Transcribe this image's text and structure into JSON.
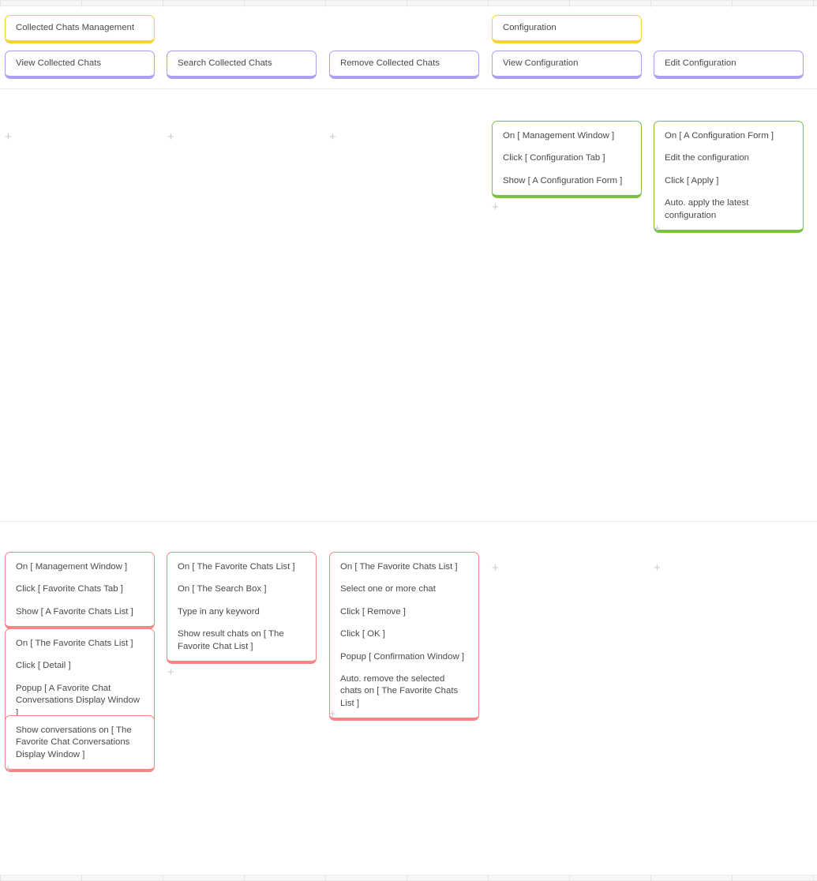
{
  "board": {
    "title_cards": [
      {
        "id": "collected-chats-management",
        "label": "Collected Chats Management",
        "color": "yellow"
      },
      {
        "id": "configuration",
        "label": "Configuration",
        "color": "yellow"
      }
    ],
    "feature_cards": [
      {
        "id": "view-collected-chats",
        "label": "View Collected Chats",
        "color": "purple"
      },
      {
        "id": "search-collected-chats",
        "label": "Search Collected Chats",
        "color": "purple"
      },
      {
        "id": "remove-collected-chats",
        "label": "Remove Collected Chats",
        "color": "purple"
      },
      {
        "id": "view-configuration",
        "label": "View Configuration",
        "color": "purple"
      },
      {
        "id": "edit-configuration",
        "label": "Edit Configuration",
        "color": "purple"
      }
    ],
    "scenario_cards": [
      {
        "id": "view-configuration-scenario",
        "color": "green",
        "steps": [
          "On [ Management Window ]",
          "Click [ Configuration Tab ]",
          "Show [ A Configuration Form ]"
        ]
      },
      {
        "id": "edit-configuration-scenario",
        "color": "green",
        "steps": [
          "On [ A Configuration Form ]",
          "Edit the configuration",
          "Click [ Apply ]",
          "Auto. apply the latest configuration"
        ]
      },
      {
        "id": "view-collected-chats-scenario-1",
        "color": "red",
        "steps": [
          "On [ Management Window ]",
          "Click [ Favorite Chats Tab ]",
          "Show [ A Favorite Chats List ]"
        ]
      },
      {
        "id": "view-collected-chats-scenario-2",
        "color": "red",
        "steps": [
          "On [ The Favorite Chats List ]",
          "Click [ Detail ]",
          "Popup [ A Favorite Chat Conversations Display Window ]"
        ]
      },
      {
        "id": "view-collected-chats-scenario-3",
        "color": "red",
        "steps": [
          "Show conversations on [ The Favorite Chat Conversations Display Window ]"
        ]
      },
      {
        "id": "search-collected-chats-scenario",
        "color": "red",
        "steps": [
          "On [ The Favorite Chats List ]",
          "On [ The Search Box ]",
          "Type in any keyword",
          "Show result chats on [ The Favorite Chat List ]"
        ]
      },
      {
        "id": "remove-collected-chats-scenario",
        "color": "red",
        "steps": [
          "On [ The Favorite Chats List ]",
          "Select one or more chat",
          "Click [ Remove ]",
          "Click [ OK ]",
          "Popup [ Confirmation Window ]",
          "Auto. remove the selected chats on [ The Favorite Chats List ]"
        ]
      }
    ],
    "add_markers": [
      {
        "id": "add-marker-1"
      },
      {
        "id": "add-marker-2"
      },
      {
        "id": "add-marker-3"
      },
      {
        "id": "add-marker-4"
      },
      {
        "id": "add-marker-5"
      },
      {
        "id": "add-marker-6"
      },
      {
        "id": "add-marker-7"
      },
      {
        "id": "add-marker-8"
      },
      {
        "id": "add-marker-9"
      },
      {
        "id": "add-marker-10"
      },
      {
        "id": "add-marker-11"
      }
    ],
    "colors": {
      "yellow": "#f8d138",
      "purple": "#aa9ff0",
      "green": "#7cc242",
      "red": "#f98484",
      "text": "#4a4a4f",
      "rail": "#f7f7f8",
      "divider": "#ededef",
      "plus": "#c9c9ce"
    }
  }
}
